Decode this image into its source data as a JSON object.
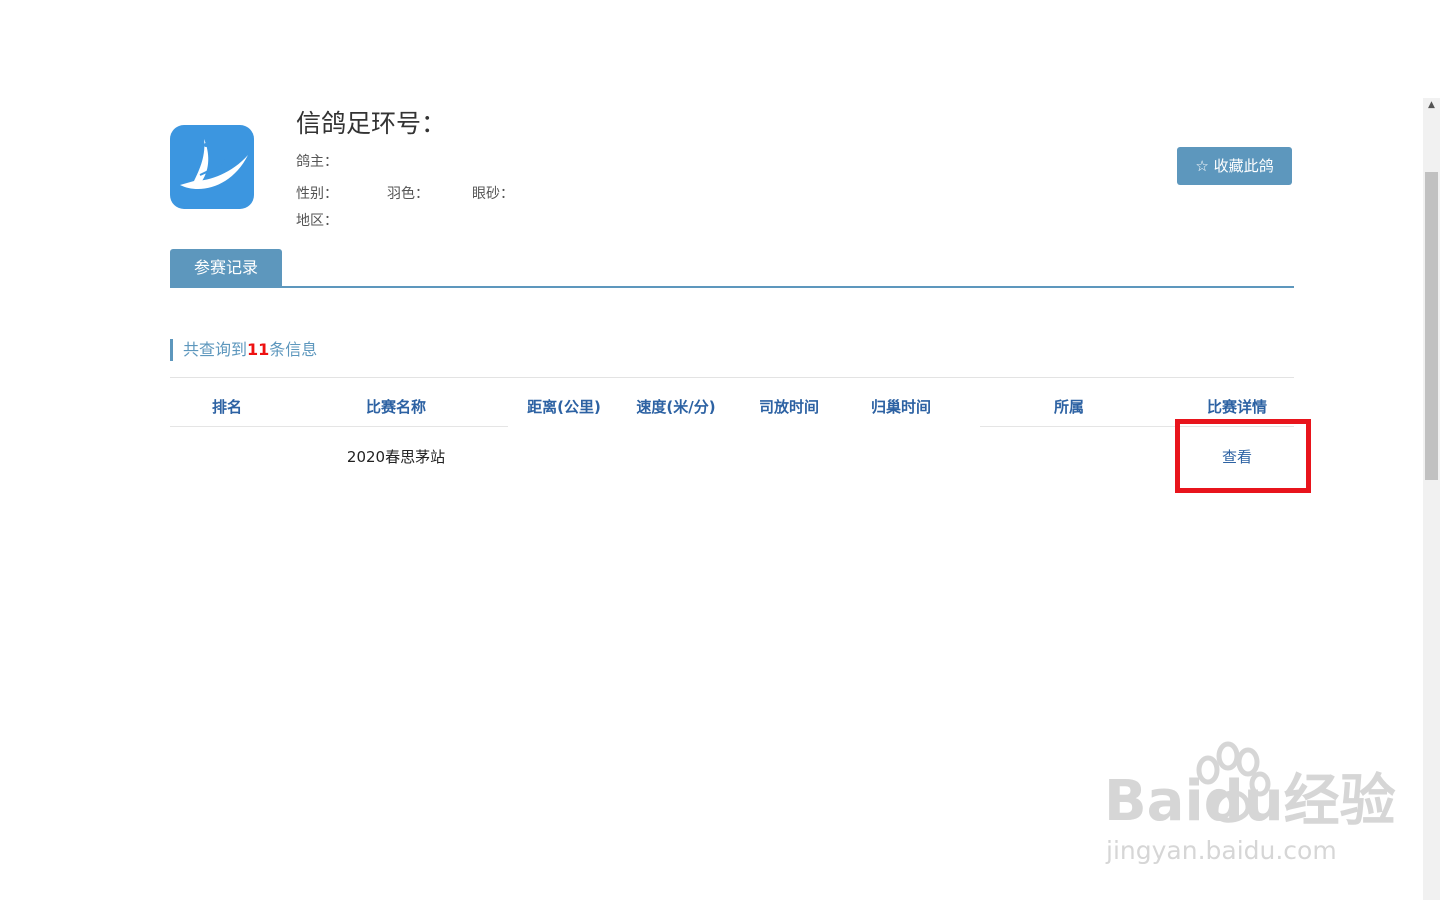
{
  "header": {
    "title": "信鸽足环号：",
    "owner_label": "鸽主：",
    "gender_label": "性别：",
    "feather_color_label": "羽色：",
    "eye_sand_label": "眼砂：",
    "region_label": "地区：",
    "favorite_button": "☆ 收藏此鸽",
    "logo_icon": "dove-logo-icon"
  },
  "tabs": [
    {
      "label": "参赛记录",
      "active": true
    }
  ],
  "summary": {
    "prefix": "共查询到",
    "count": "11",
    "suffix": "条信息"
  },
  "table": {
    "columns": [
      "排名",
      "比赛名称",
      "距离(公里)",
      "速度(米/分)",
      "司放时间",
      "归巢时间",
      "所属",
      "比赛详情"
    ],
    "rows": [
      {
        "rank": "",
        "race_name": "2020春思茅站",
        "distance": "",
        "speed": "",
        "release_time": "",
        "return_time": "",
        "affiliation": "",
        "detail_link": "查看"
      }
    ]
  },
  "watermark": {
    "main": "Baidu经验",
    "sub": "jingyan.baidu.com"
  },
  "colors": {
    "accent": "#5d97bd",
    "header_text": "#2d62a3",
    "count": "#e11111",
    "highlight": "#e8141c",
    "logo_bg": "#3c96e0"
  }
}
